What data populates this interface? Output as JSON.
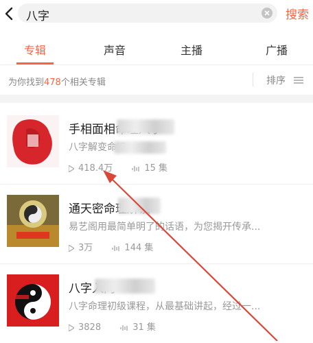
{
  "search": {
    "query": "八字",
    "button_label": "搜索"
  },
  "tabs": [
    {
      "label": "专辑",
      "active": true
    },
    {
      "label": "声音",
      "active": false
    },
    {
      "label": "主播",
      "active": false
    },
    {
      "label": "广播",
      "active": false
    }
  ],
  "summary": {
    "prefix": "为你找到",
    "count": "478",
    "suffix": "个相关专辑",
    "sort_label": "排序"
  },
  "albums": [
    {
      "title": "手相面相命理八字",
      "desc": "八字解变命运。",
      "plays": "418.4万",
      "tracks": "15 集"
    },
    {
      "title": "通天密命理解读",
      "desc": "易艺阁用最简单明了的话语，为您揭开传承...",
      "plays": "3万",
      "tracks": "144 集"
    },
    {
      "title": "八字入门",
      "desc": "八字命理初级课程，从最基础讲起，经过一...",
      "plays": "3828",
      "tracks": "31 集"
    }
  ],
  "colors": {
    "accent": "#f86442",
    "annotation_arrow": "#d9473a"
  },
  "icons": [
    "back-arrow-icon",
    "clear-icon",
    "sort-lines-icon",
    "play-icon",
    "audio-wave-icon"
  ]
}
